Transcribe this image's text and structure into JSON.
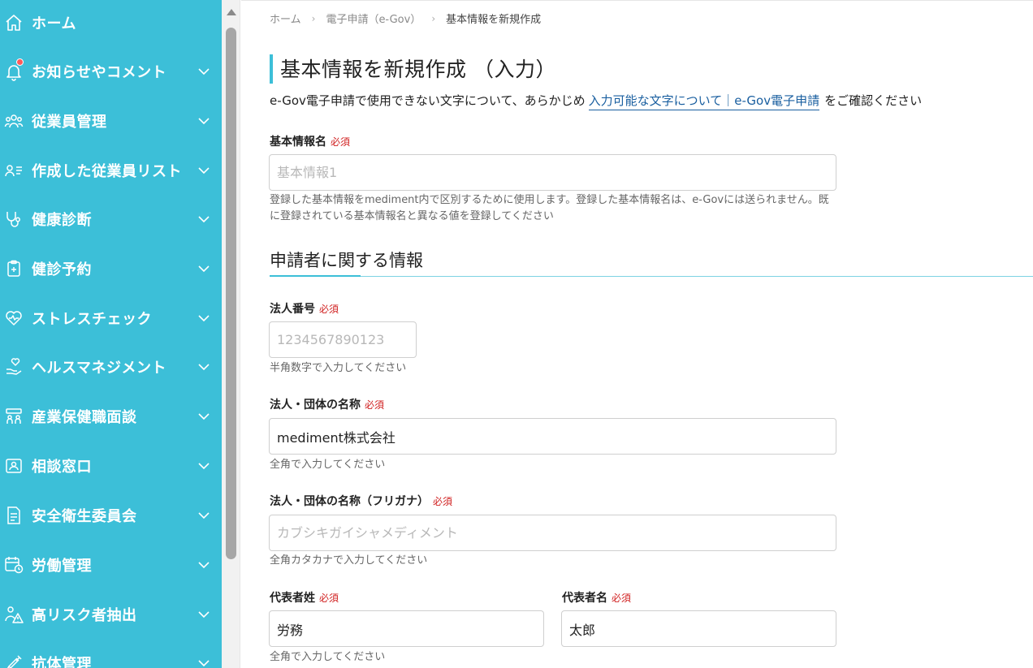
{
  "sidebar": {
    "items": [
      {
        "label": "ホーム",
        "icon": "home-icon"
      },
      {
        "label": "お知らせやコメント",
        "icon": "bell-icon"
      },
      {
        "label": "従業員管理",
        "icon": "users-icon"
      },
      {
        "label": "作成した従業員リスト",
        "icon": "user-list-icon"
      },
      {
        "label": "健康診断",
        "icon": "stethoscope-icon"
      },
      {
        "label": "健診予約",
        "icon": "clipboard-icon"
      },
      {
        "label": "ストレスチェック",
        "icon": "heart-icon"
      },
      {
        "label": "ヘルスマネジメント",
        "icon": "hand-heart-icon"
      },
      {
        "label": "産業保健職面談",
        "icon": "meeting-icon"
      },
      {
        "label": "相談窓口",
        "icon": "id-card-icon"
      },
      {
        "label": "安全衛生委員会",
        "icon": "document-icon"
      },
      {
        "label": "労働管理",
        "icon": "calendar-icon"
      },
      {
        "label": "高リスク者抽出",
        "icon": "warning-person-icon"
      },
      {
        "label": "抗体管理",
        "icon": "syringe-icon"
      }
    ]
  },
  "breadcrumb": {
    "home": "ホーム",
    "parent": "電子申請（e-Gov）",
    "current": "基本情報を新規作成"
  },
  "page": {
    "title": "基本情報を新規作成 （入力）",
    "notice_prefix": "e-Gov電子申請で使用できない文字について、あらかじめ",
    "notice_link": "入力可能な文字について｜e-Gov電子申請",
    "notice_suffix": "をご確認ください"
  },
  "form": {
    "required": "必須",
    "basic_name": {
      "label": "基本情報名",
      "placeholder": "基本情報1",
      "value": "",
      "help": "登録した基本情報をmediment内で区別するために使用します。登録した基本情報名は、e-Govには送られません。既に登録されている基本情報名と異なる値を登録してください"
    },
    "section_title": "申請者に関する情報",
    "corp_number": {
      "label": "法人番号",
      "placeholder": "1234567890123",
      "value": "",
      "help": "半角数字で入力してください"
    },
    "corp_name": {
      "label": "法人・団体の名称",
      "placeholder": "",
      "value": "mediment株式会社",
      "help": "全角で入力してください"
    },
    "corp_name_kana": {
      "label": "法人・団体の名称（フリガナ）",
      "placeholder": "カブシキガイシャメディメント",
      "value": "",
      "help": "全角カタカナで入力してください"
    },
    "rep_last": {
      "label": "代表者姓",
      "value": "労務",
      "help": "全角で入力してください"
    },
    "rep_first": {
      "label": "代表者名",
      "value": "太郎"
    }
  },
  "colors": {
    "sidebar": "#3cbfd8",
    "accent": "#3cbfd8",
    "required": "#d02020",
    "link": "#1a5fa0"
  }
}
